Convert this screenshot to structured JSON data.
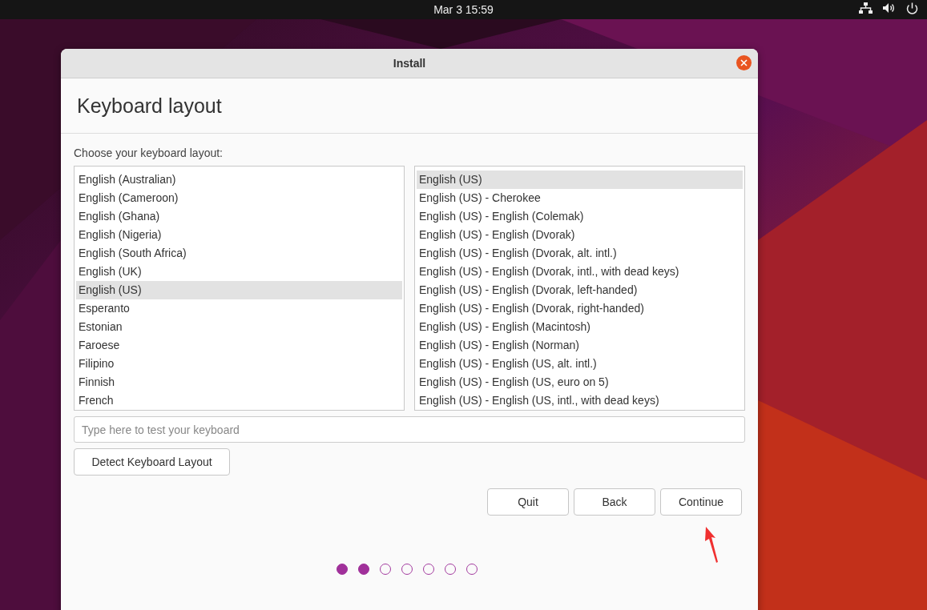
{
  "top_bar": {
    "clock": "Mar 3  15:59"
  },
  "window": {
    "title": "Install"
  },
  "page": {
    "heading": "Keyboard layout",
    "prompt": "Choose your keyboard layout:"
  },
  "layouts": [
    {
      "label": "English (Australian)",
      "selected": false
    },
    {
      "label": "English (Cameroon)",
      "selected": false
    },
    {
      "label": "English (Ghana)",
      "selected": false
    },
    {
      "label": "English (Nigeria)",
      "selected": false
    },
    {
      "label": "English (South Africa)",
      "selected": false
    },
    {
      "label": "English (UK)",
      "selected": false
    },
    {
      "label": "English (US)",
      "selected": true
    },
    {
      "label": "Esperanto",
      "selected": false
    },
    {
      "label": "Estonian",
      "selected": false
    },
    {
      "label": "Faroese",
      "selected": false
    },
    {
      "label": "Filipino",
      "selected": false
    },
    {
      "label": "Finnish",
      "selected": false
    },
    {
      "label": "French",
      "selected": false
    }
  ],
  "variants": [
    {
      "label": "English (US)",
      "selected": true
    },
    {
      "label": "English (US) - Cherokee",
      "selected": false
    },
    {
      "label": "English (US) - English (Colemak)",
      "selected": false
    },
    {
      "label": "English (US) - English (Dvorak)",
      "selected": false
    },
    {
      "label": "English (US) - English (Dvorak, alt. intl.)",
      "selected": false
    },
    {
      "label": "English (US) - English (Dvorak, intl., with dead keys)",
      "selected": false
    },
    {
      "label": "English (US) - English (Dvorak, left-handed)",
      "selected": false
    },
    {
      "label": "English (US) - English (Dvorak, right-handed)",
      "selected": false
    },
    {
      "label": "English (US) - English (Macintosh)",
      "selected": false
    },
    {
      "label": "English (US) - English (Norman)",
      "selected": false
    },
    {
      "label": "English (US) - English (US, alt. intl.)",
      "selected": false
    },
    {
      "label": "English (US) - English (US, euro on 5)",
      "selected": false
    },
    {
      "label": "English (US) - English (US, intl., with dead keys)",
      "selected": false
    }
  ],
  "test_field": {
    "placeholder": "Type here to test your keyboard"
  },
  "detect_button": "Detect Keyboard Layout",
  "buttons": [
    "Quit",
    "Back",
    "Continue"
  ],
  "steps": [
    {
      "filled": true
    },
    {
      "filled": true
    },
    {
      "filled": false
    },
    {
      "filled": false
    },
    {
      "filled": false
    },
    {
      "filled": false
    },
    {
      "filled": false
    }
  ]
}
